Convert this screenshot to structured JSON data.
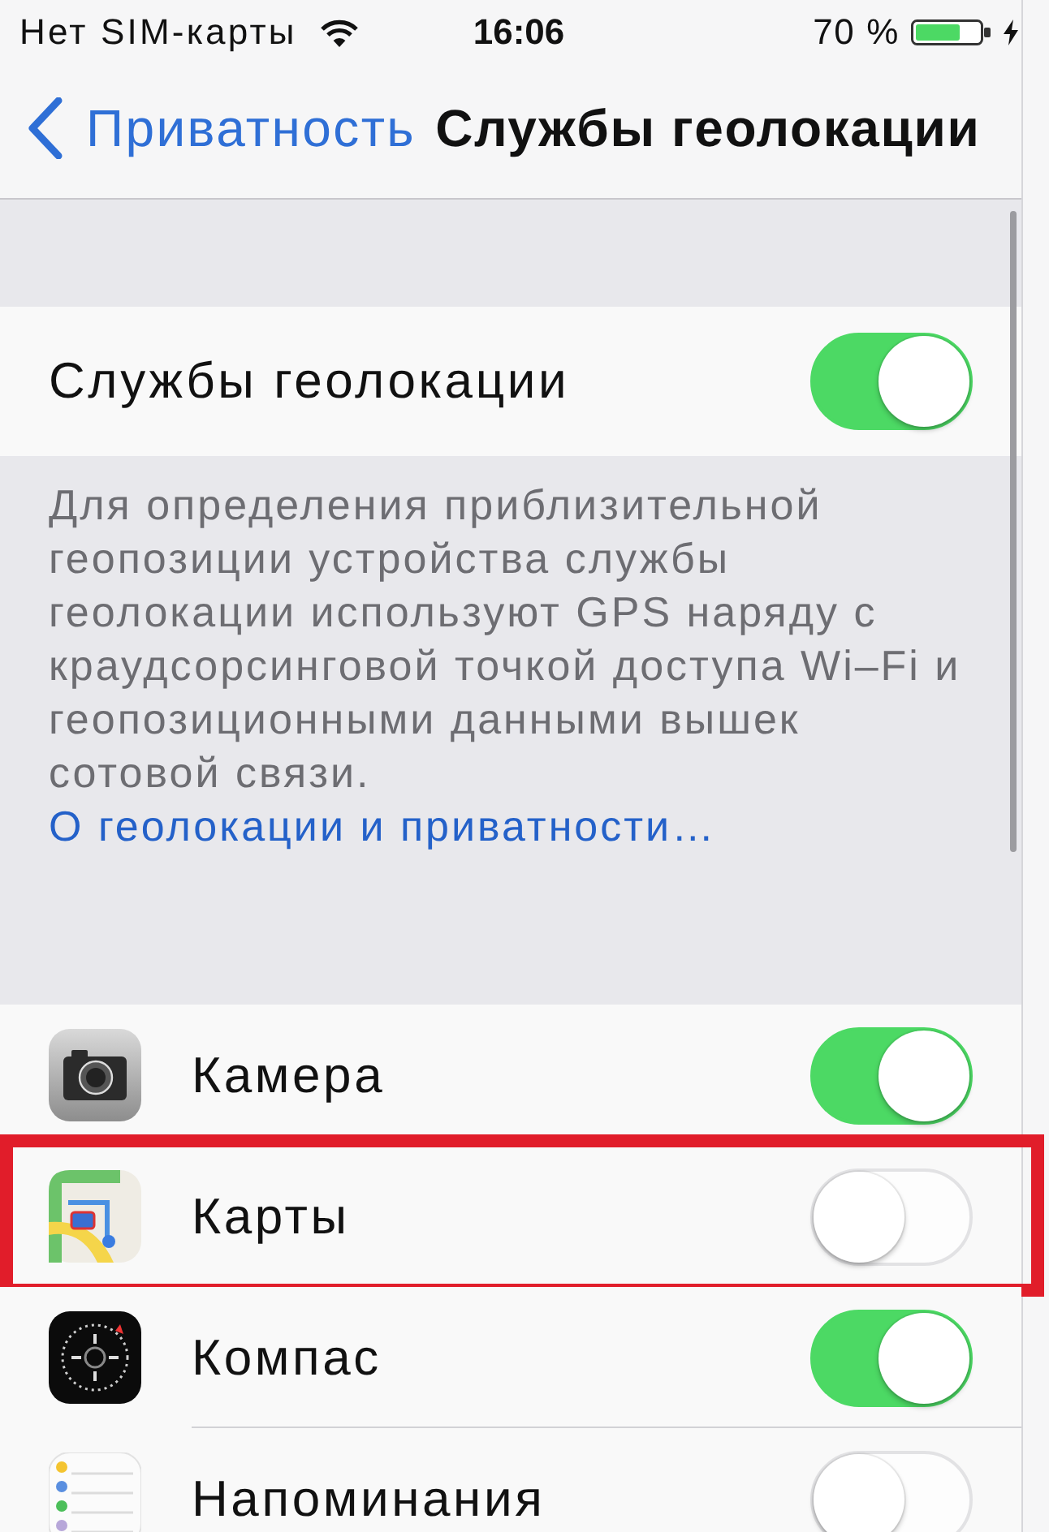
{
  "status_bar": {
    "carrier": "Нет SIM-карты",
    "time": "16:06",
    "battery": "70 %"
  },
  "nav_bar": {
    "back": "Приватность",
    "title": "Службы геолокации"
  },
  "master": {
    "label": "Службы геолокации",
    "on": true
  },
  "footer": {
    "text": "Для определения приблизительной геопозиции устройства службы геолокации используют GPS наряду с краудсорсинговой точкой доступа Wi–Fi и геопозиционными данными вышек сотовой связи.",
    "link": "О геолокации и приватности…"
  },
  "apps": [
    {
      "kind": "camera",
      "name": "Камера",
      "on": true,
      "highlighted": false
    },
    {
      "kind": "maps",
      "name": "Карты",
      "on": false,
      "highlighted": true
    },
    {
      "kind": "compass",
      "name": "Компас",
      "on": true,
      "highlighted": false
    },
    {
      "kind": "reminders",
      "name": "Напоминания",
      "on": false,
      "highlighted": false
    }
  ]
}
